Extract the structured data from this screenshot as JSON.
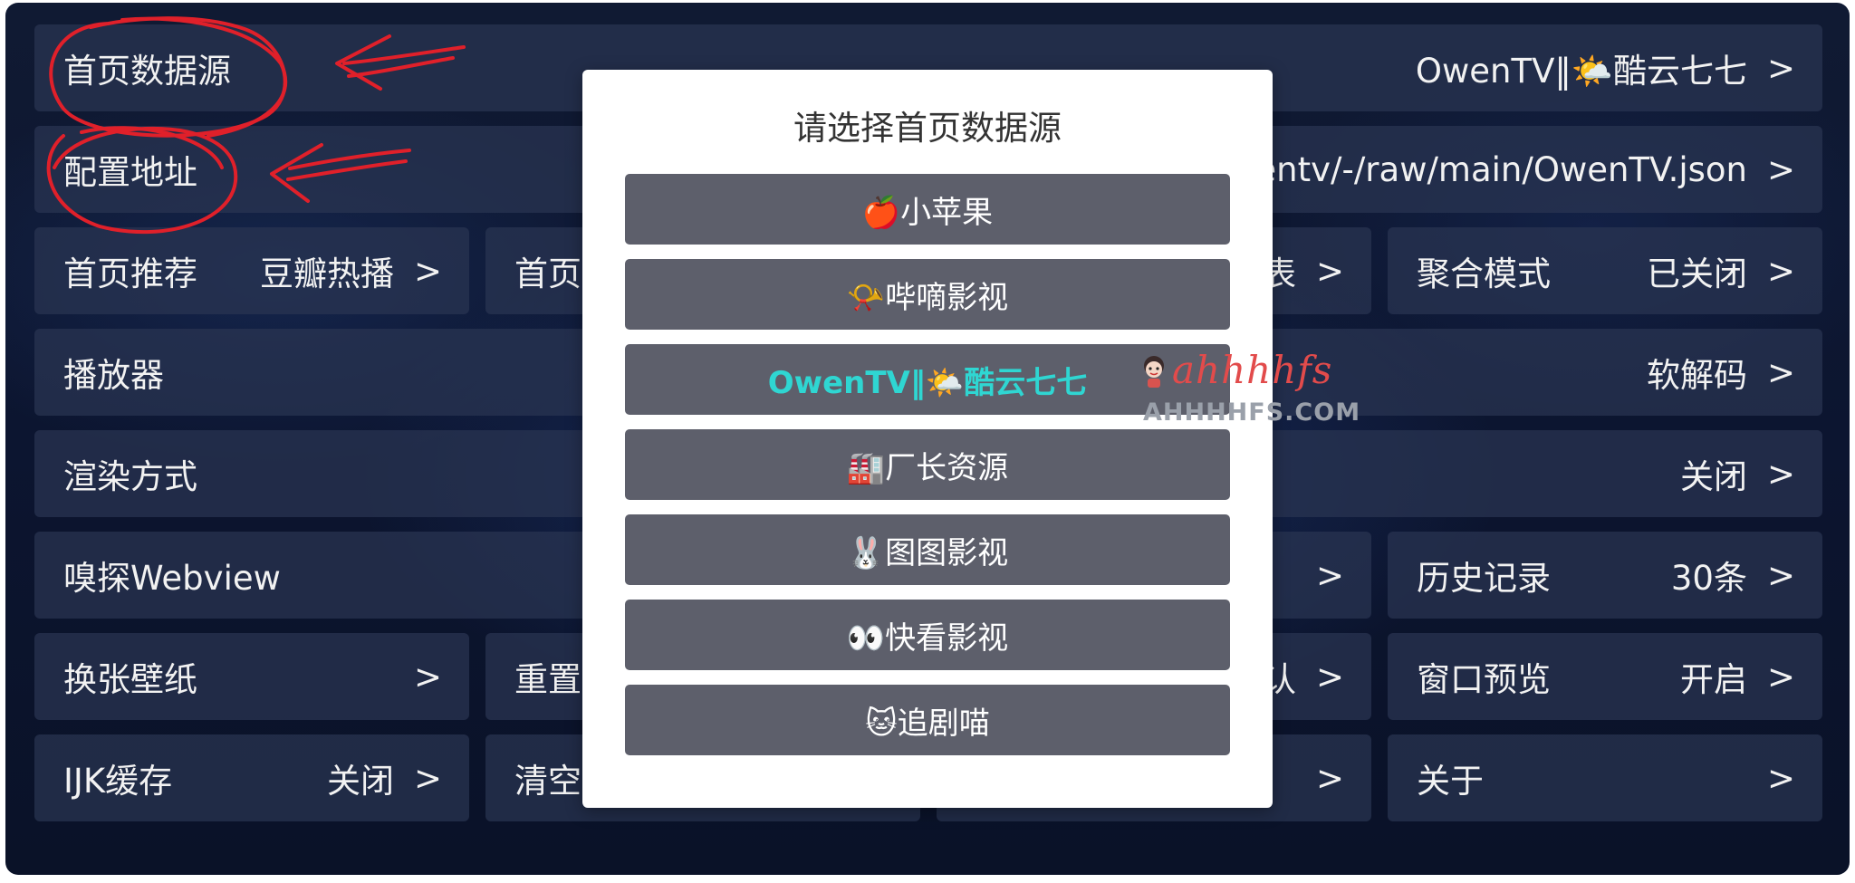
{
  "settings": {
    "home_source": {
      "label": "首页数据源",
      "value": "OwenTV‖🌤️酷云七七",
      "chevron": ">"
    },
    "config_url": {
      "label": "配置地址",
      "value": "wentv/-/raw/main/OwenTV.json",
      "chevron": ">"
    },
    "home_recommend": {
      "label": "首页推荐",
      "value": "豆瓣热播",
      "chevron": ">"
    },
    "home_col2": {
      "label": "首页"
    },
    "home_col3": {
      "value": "表",
      "chevron": ">"
    },
    "aggregate_mode": {
      "label": "聚合模式",
      "value": "已关闭",
      "chevron": ">"
    },
    "player": {
      "label": "播放器",
      "value": "软解码",
      "chevron": ">"
    },
    "render_mode": {
      "label": "渲染方式",
      "value": "关闭",
      "chevron": ">"
    },
    "sniff_webview": {
      "label": "嗅探Webview"
    },
    "sniff_col3": {
      "chevron": ">"
    },
    "history": {
      "label": "历史记录",
      "value": "30条",
      "chevron": ">"
    },
    "wallpaper": {
      "label": "换张壁纸",
      "chevron": ">"
    },
    "reset_col2": {
      "label": "重置"
    },
    "reset_col3": {
      "value": "认",
      "chevron": ">"
    },
    "window_preview": {
      "label": "窗口预览",
      "value": "开启",
      "chevron": ">"
    },
    "ijk_cache": {
      "label": "IJK缓存",
      "value": "关闭",
      "chevron": ">"
    },
    "clear_col2": {
      "label": "清空"
    },
    "clear_col3": {
      "chevron": ">"
    },
    "about": {
      "label": "关于",
      "chevron": ">"
    }
  },
  "dialog": {
    "title": "请选择首页数据源",
    "options": [
      {
        "label": "🍎小苹果",
        "selected": false
      },
      {
        "label": "📯哔嘀影视",
        "selected": false
      },
      {
        "label": "OwenTV‖🌤️酷云七七",
        "selected": true
      },
      {
        "label": "🏭厂长资源",
        "selected": false
      },
      {
        "label": "🐰图图影视",
        "selected": false
      },
      {
        "label": "👀快看影视",
        "selected": false
      },
      {
        "label": "🐱追剧喵",
        "selected": false
      }
    ],
    "selected_color": "#2fd6d2"
  },
  "watermark": {
    "main": "ahhhhfs",
    "sub": "AHHHHFS.COM"
  },
  "colors": {
    "background": "#0c1530",
    "row": "#2a3452",
    "option": "#5d5f6b",
    "annotation": "#e0202a"
  }
}
